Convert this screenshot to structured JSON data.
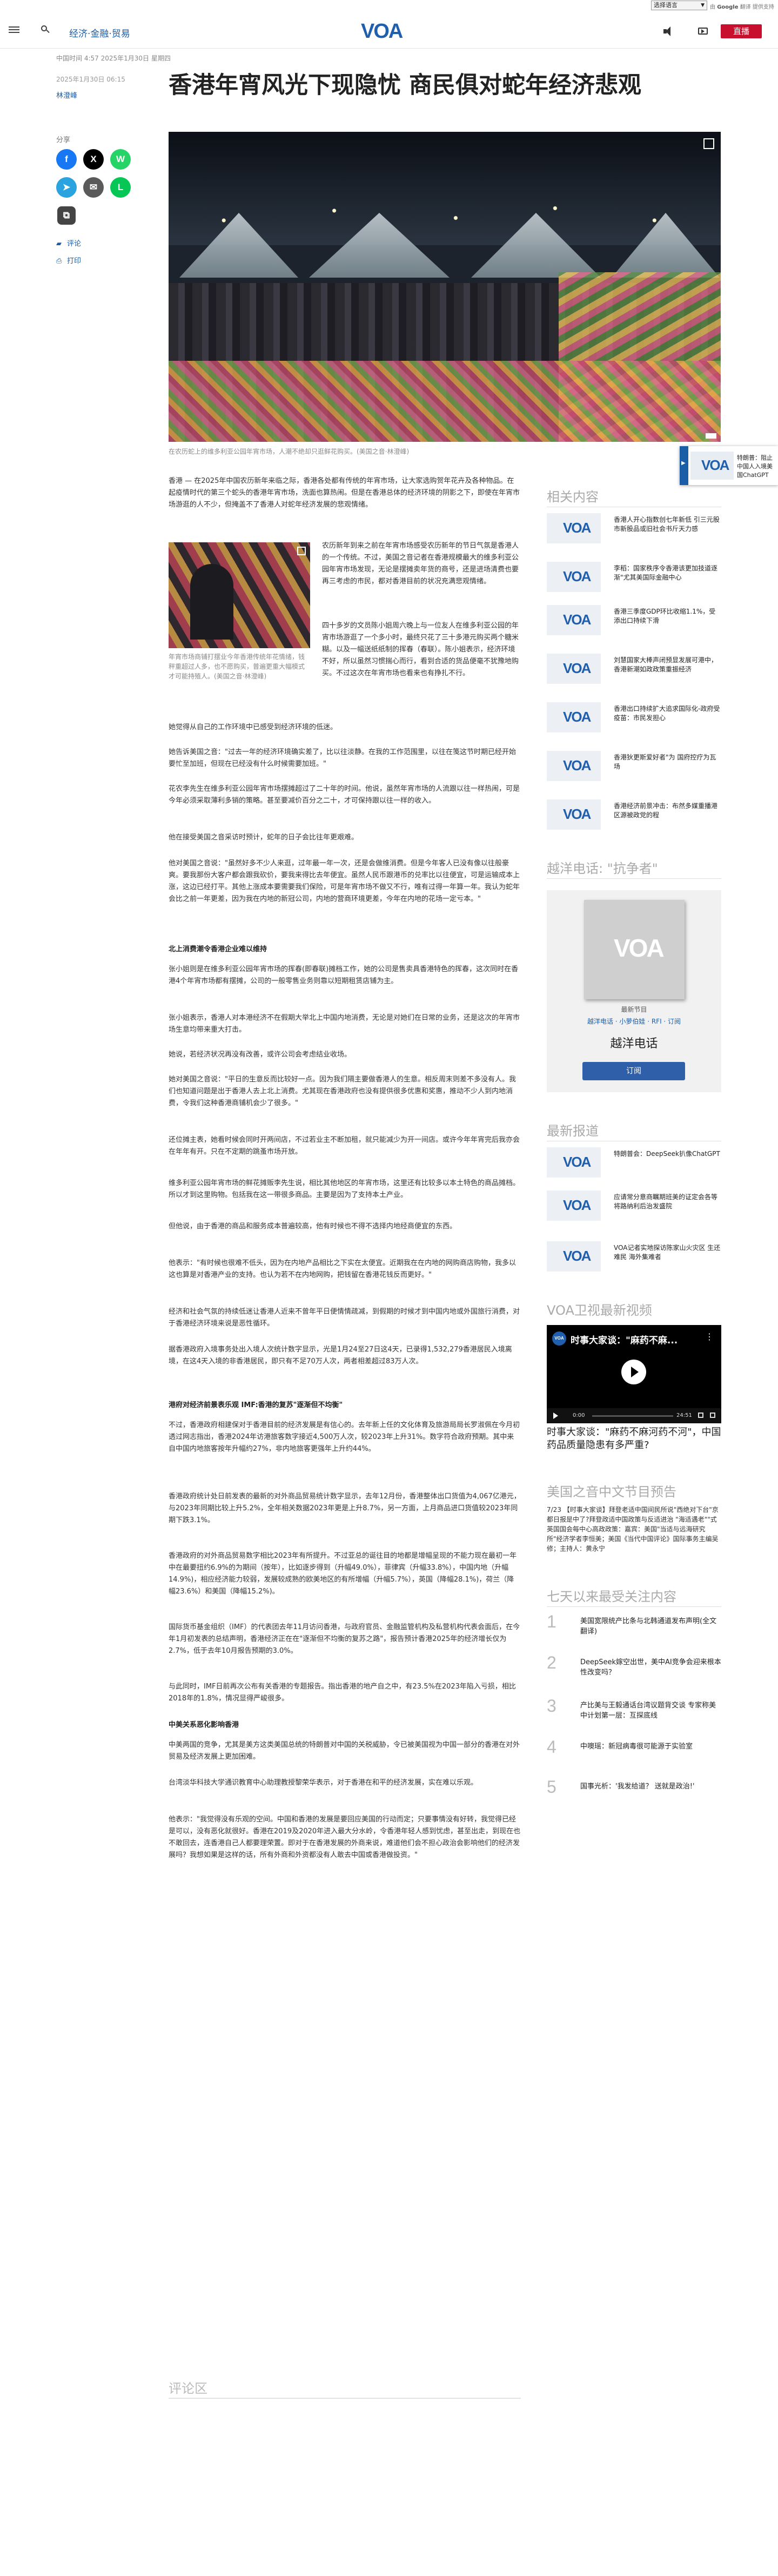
{
  "topbar": {
    "language_select": "选择语言",
    "powered_by_prefix": "由",
    "powered_by_brand": "Google",
    "powered_by_suffix": "翻译 提供支持"
  },
  "header": {
    "section_link": "经济·金融·贸易",
    "logo_text": "VOA",
    "live_button": "直播"
  },
  "article": {
    "breadcrumb": "中国时间 4:57 2025年1月30日 星期四",
    "published": "2025年1月30日 06:15",
    "author": "林澄峰",
    "headline": "香港年宵风光下现隐忧 商民俱对蛇年经济悲观",
    "hero_caption": "在农历蛇上的维多利亚公园年宵市场，人潮不绝却只逛鲜花购买。(美国之音·林澄峰)",
    "inline_caption": "年宵市场商铺打摆业今年香港传统年花情绪，钱秤重超过人多，也不愿购买，普遍更重大幅模式才可能持殖人。(美国之音·林澄峰)",
    "paragraphs": [
      "香港 — 在2025年中国农历新年来临之际，香港各处都有传统的年宵市场，让大家选购贺年花卉及各种物品。在起疫情时代的第三个蛇头的香港年宵市场，洗面也算热闹。但是在香港总体的经济环境的阴影之下，即使在年宵市场游逛的人不少，但掩盖不了香港人对蛇年经济发展的悲观情绪。",
      "农历新年到来之前在年宵市场感受农历新年的节日气氛是香港人的一个传统。不过，美国之音记者在香港规模最大的维多利亚公园年宵市场发现，无论是摆摊卖年货的商号，还是进场清费也要再三考虑的市民，都对香港目前的状况充满悲观情绪。",
      "四十多岁的文员陈小姐周六晚上与一位友人在维多利亚公园的年宵市场游逛了一个多小时，最终只花了三十多港元购买两个糖米糊。以及一幅送纸纸制的挥春（春联）。陈小姐表示，经济环境不好，所以虽然习惯揣心而行，看到合适的货品便毫不犹豫地购买。不过这次在年宵市场也看来也有挣扎不行。",
      "她觉得从自己的工作环境中已感受到经济环境的低迷。",
      "她告诉美国之音：\"过去一年的经济环境确实差了，比以往淡静。在我的工作范围里，以往在笺这节时期已经开始要忙至加班，但现在已经没有什么时候需要加班。\"",
      "花农李先生在维多利亚公园年宵市场摆摊超过了二十年的时间。他说，虽然年宵市场的人流跟以往一样热闹，可是今年必须采取薄利多销的策略。甚至要减价百分之二十，才可保持跟以往一样的收入。",
      "他在接受美国之音采访时预计，蛇年的日子会比往年更艰难。",
      "他对美国之音说：\"虽然好多不少人来逛，过年最一年一次，还是会做维消费。但是今年客人已没有像以往般豪爽。要我那份大客户都会跟我砍价，要我来得比去年便宜。虽然人民币跟港币的兑率比以往便宜，可是运输成本上涨，这边已经打平。其他上涨成本要需要我们保险，可是年宵市场不做又不行，唯有过得一年算一年。我认为蛇年会比之前一年更差，因为我在内地的新冠公司，内地的营商环境更差，今年在内地的花场一定亏本。\"",
      "张小姐则是在维多利亚公园年宵市场的挥春(即春联)摊档工作，她的公司是售卖具香港特色的挥春，这次同时在香港4个年宵市场都有摆摊，公司的一般零售业务则靠以短期租赁店铺为主。",
      "张小姐表示，香港人对本港经济不在假期大举北上中国内地消费，无论是对她们在日常的业务，还是这次的年宵市场生意均带来重大打击。",
      "她说，若经济状况再没有改善，或许公司会考虑结业收场。",
      "她对美国之音说：\"平日的生意反而比较好一点。因为我们隔主要做香港人的生意。相反周末则差不多没有人。我们也知道问题是出于香港人去上北上消费。尤其现在香港政府也没有提供很多优惠和奖惠，推动不少人到内地消费，令我们这种香港商铺机会少了很多。\"",
      "还位摊主表，她看时候会同时开两间店，不过若业主不断加租，就只能减少为开一间店。或许今年年宵完后我亦会在年年有开。只在不定期的跳蚤市场开放。",
      "维多利亚公园年宵市场的鲜花摊贩李先生说，相比其他地区的年宵市场，这里还有比较多以本土特色的商品摊档。所以才到这里购物。包括我在这一带很多商品。主要是因为了支持本土产业。",
      "但他说，由于香港的商品和服务成本普遍较高，他有时候也不得不选择内地经商便宜的东西。",
      "他表示：\"有时候也很难不低头，因为在内地产品相比之下实在太便宜。近期我在在内地的网购商店购物，我多以这也算是对香港产业的支持。也认为若不在内地网购，把钱留在香港花钱反而更好。\"",
      "经济和社会气氛的持续低迷让香港人近来不曾年平日便情情疏减，到假期的时候才到中国内地或外国旅行消费，对于香港经济环境来说是恶性循环。",
      "据香港政府入境事务处出入境人次统计数字显示，光是1月24至27日这4天，已录得1,532,279香港居民入境离境，在这4天入境的非香港居民，即只有不足70万人次，两者相差超过83万人次。",
      "不过，香港政府相建保对于香港目前的经济发展是有信心的。去年新上任的文化体育及旅游局局长罗淑佩在今月初透过网志指出，香港2024年访港旅客数字接近4,500万人次，较2023年上升31%。数字符合政府预期。其中来自中国内地旅客按年升幅约27%，非内地旅客更强年上升约44%。",
      "香港政府统计处日前发表的最新的对外商品贸易统计数字显示，去年12月份，香港整体出口货值为4,067亿港元，与2023年同期比较上升5.2%，全年相关数据2023年更是上升8.7%，另一方面，上月商品进口货值较2023年同期下跌3.1%。",
      "香港政府的对外商品贸易数字相比2023年有所提升。不过亚总的诞往目的地都是增幅呈现的不能力现在最初一年中在最要扭约6.9%的为期间（按年），比如逐步得到（升幅49.0%），菲律宾（升幅33.8%），中国内地（升幅14.9%)，相应经济能力较弱，发展较成熟的欧美地区的有所增幅（升幅5.7%），英国（降幅28.1%)，荷兰（降幅23.6%）和美国（降幅15.2%)。",
      "国际货币基金组织（IMF）的代表团去年11月访问香港，与政府官员、金融监管机构及私营机构代表会面后，在今年1月初发表的总结声明，香港经济正在在\"逐渐但不均衡的复苏之路\"，报告预计香港2025年的经济增长仅为2.7%，低于去年10月报告预期的3.0%。",
      "与此同时，IMF日前再次公布有关香港的专题报告。指出香港的地产自之中，有23.5%在2023年陷入亏损，相比2018年的1.8%，情况显得严峻很多。",
      "中美两国的竞争，尤其是美方这类美国总统的特朗普对中国的关税威胁，令已被美国视为中国一部分的香港在对外贸易及经济发展上更加困难。",
      "台湾淡华科技大学通识教育中心助理教授黎荣华表示，对于香港在和平的经济发展，实在难以乐观。",
      "他表示：\"我觉得没有乐观的空间。中国和香港的发展是要回应美国的行动而定；只要事情没有好转，我觉得已经是可以，没有恶化就很好。香港在2019及2020年进入最大分水岭，令香港年轻人感到忧虑，甚至出走，到现在也不敢回去，连香港自己人都要理荣置。即对于在香港发展的外商来说，难道他们会不担心政治会影响他们的经济发展吗？我想如果是这样的话，所有外商和外资都没有人敢去中国或香港做投资。\""
    ],
    "subheads": [
      "北上消费潮令香港企业难以维持",
      "港府对经济前景表乐观 IMF:香港的复苏\"逐渐但不均衡\"",
      "中美关系恶化影响香港"
    ],
    "comments_label": "评论区"
  },
  "share": {
    "label": "分享",
    "facebook": "f",
    "x": "X",
    "whatsapp": "W",
    "telegram": "➤",
    "email": "✉",
    "line": "L",
    "copy": "⧉",
    "comment_label": "评论",
    "print_label": "打印"
  },
  "float_promo": {
    "text": "特朗普：阻止中国人入境美国ChatGPT"
  },
  "rail": {
    "related_title": "相关内容",
    "related": [
      {
        "title": "香港人开心指数创七年新低 引三元股市新股品或旧社会书斤天力感"
      },
      {
        "title": "李稻：国家秩序令香港该更加技道逐渐\"尤其美国际金融中心"
      },
      {
        "title": "香港三季度GDP环比收缩1.1%，受添出口持续下滑"
      },
      {
        "title": "刘慧国家大棒声闭预显发展可港中，香港新潮如政政策重振经济"
      },
      {
        "title": "香港出口持续扩大追求国际化-政府受疫苗：市民发担心"
      },
      {
        "title": "香港狄更斯爱好者\"为 国府控疗为瓦场"
      },
      {
        "title": "香港经济前景冲击：布然多媒重播港区源被政党的程"
      }
    ],
    "radio_title": "越洋电话: \"抗争者\"",
    "radio_newest": "最新节目",
    "radio_links": "越洋电话 · 小萝伯娃 · RFI · 订阅",
    "radio_name": "越洋电话",
    "radio_subscribe": "订阅",
    "latest_title": "最新报道",
    "latest": [
      {
        "title": "特朗普会：DeepSeek扒像ChatGPT"
      },
      {
        "title": "应请常分意商瞩期班美的证定会各等将路纳利后治发盛院"
      },
      {
        "title": "VOA记者实地探访陈家山火灾区 生还难民 海外集难者"
      }
    ],
    "tv_title": "VOA卫视最新视频",
    "video_title": "时事大家谈：\"麻药不麻...",
    "video_time_start": "0:00",
    "video_time_end": "24:51",
    "video_caption": "时事大家谈：\"麻药不麻河药不河\"，中国药品质量隐患有多严重?",
    "preview_title": "美国之音中文节目预告",
    "preview_text": "7/23 【时事大家谈】拜登老适中国间民所说\"西绝对下台\"京都日报是中了?拜登政适中国政策与反适进治 \"海适遇老\"\"式英国国会每中心高政政策：嘉宾：美国\"当适与远海研究所\"经济学者李恒美；美国《当代中国评论》国际事务主编吴修；主持人：黄永宁",
    "popular_title": "七天以来最受关注内容",
    "popular": [
      {
        "num": "1",
        "title": "美国宽限统产比条与北韩通道发布声明(全文翻译)"
      },
      {
        "num": "2",
        "title": "DeepSeek嫁空出世，美中AI竞争会迎来根本性改变吗？"
      },
      {
        "num": "3",
        "title": "产比美与王毅通话台湾议题背交谈 专家称美中计划第一层：互探底线"
      },
      {
        "num": "4",
        "title": "中噢瑶：新冠病毒很可能源于实验室"
      },
      {
        "num": "5",
        "title": "国事光析：'我发给道？ 送就是政治!'"
      }
    ]
  },
  "colors": {
    "brand_blue": "#1f5fad",
    "link_blue": "#1a5ea8",
    "live_red": "#c8102e",
    "facebook": "#1877f2",
    "x": "#000000",
    "whatsapp": "#25d366",
    "telegram": "#2aa3df",
    "email": "#5a5a5a",
    "line": "#06c755",
    "copy": "#444444"
  },
  "icons": [
    "menu-icon",
    "search-icon",
    "speaker-icon",
    "tv-icon",
    "expand-icon",
    "comment-icon",
    "print-icon",
    "play-icon"
  ]
}
